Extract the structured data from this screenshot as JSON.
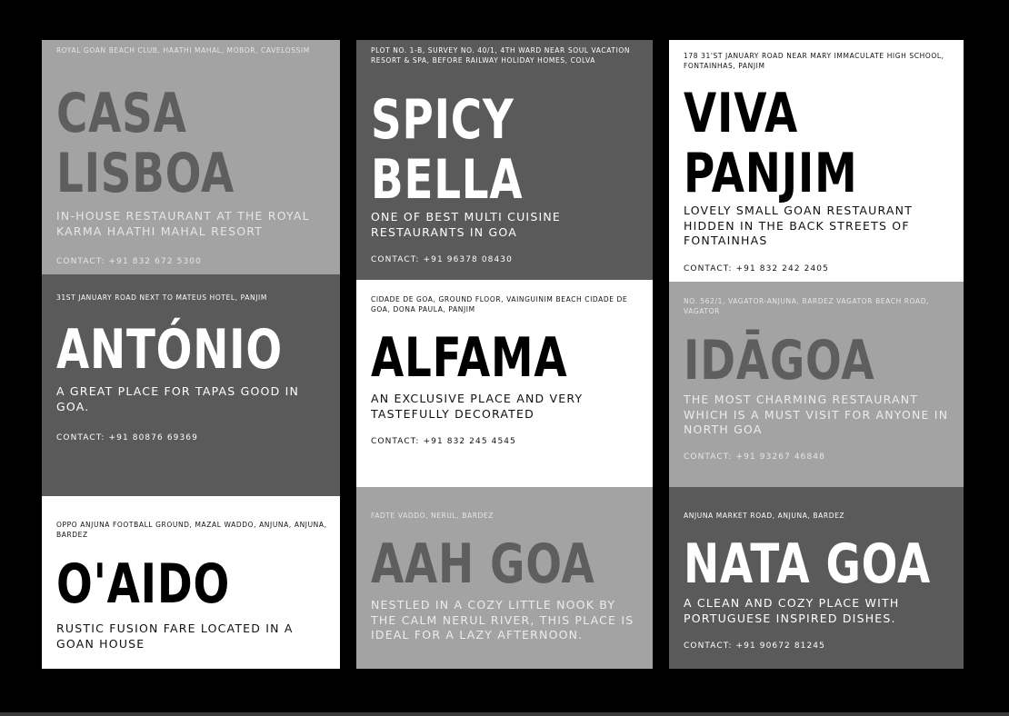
{
  "colors": {
    "background": "#000000",
    "light_gray": "#a3a3a3",
    "dark_gray": "#5a5a5a",
    "white": "#ffffff"
  },
  "cards": [
    {
      "address": "ROYAL GOAN BEACH CLUB, HAATHI MAHAL, MOBOR, CAVELOSSIM",
      "name": "CASA\nLISBOA",
      "description": " IN-HOUSE RESTAURANT AT THE ROYAL KARMA HAATHI MAHAL RESORT",
      "contact": "CONTACT: +91 832 672 5300"
    },
    {
      "address": "PLOT NO. 1-B, SURVEY NO. 40/1, 4TH WARD NEAR SOUL VACATION RESORT & SPA, BEFORE RAILWAY HOLIDAY HOMES, COLVA",
      "name": "SPICY\nBELLA",
      "description": "ONE OF BEST MULTI CUISINE RESTAURANTS IN GOA",
      "contact": "CONTACT: +91 96378 08430"
    },
    {
      "address": "178 31'ST JANUARY ROAD NEAR MARY IMMACULATE HIGH SCHOOL, FONTAINHAS, PANJIM",
      "name": "VIVA\nPANJIM",
      "description": "LOVELY SMALL GOAN RESTAURANT HIDDEN IN THE BACK STREETS OF FONTAINHAS",
      "contact": "CONTACT: +91 832 242 2405"
    },
    {
      "address": "31ST JANUARY ROAD NEXT TO MATEUS HOTEL, PANJIM",
      "name": "ANTÓNIO",
      "description": "A GREAT PLACE FOR TAPAS GOOD IN GOA.",
      "contact": "CONTACT: +91 80876 69369"
    },
    {
      "address": "CIDADE DE GOA, GROUND FLOOR, VAINGUINIM BEACH CIDADE DE GOA, DONA PAULA, PANJIM",
      "name": "ALFAMA",
      "description": "AN EXCLUSIVE PLACE AND VERY TASTEFULLY DECORATED",
      "contact": "CONTACT: +91 832 245 4545"
    },
    {
      "address": "NO. 562/1, VAGATOR-ANJUNA, BARDEZ VAGATOR BEACH ROAD, VAGATOR",
      "name": "IDĀGOA",
      "description": "THE MOST CHARMING RESTAURANT WHICH IS A MUST VISIT FOR ANYONE IN NORTH GOA",
      "contact": "CONTACT: +91 93267 46848"
    },
    {
      "address": "OPPO ANJUNA FOOTBALL GROUND, MAZAL WADDO, ANJUNA, ANJUNA, BARDEZ",
      "name": "O'AIDO",
      "description": "RUSTIC FUSION FARE LOCATED IN A GOAN HOUSE",
      "contact": ""
    },
    {
      "address": "FADTE VADDO, NERUL, BARDEZ",
      "name": "AAH GOA",
      "description": "NESTLED IN A COZY LITTLE NOOK BY THE CALM NERUL RIVER, THIS PLACE IS IDEAL FOR A LAZY AFTERNOON.",
      "contact": ""
    },
    {
      "address": "ANJUNA MARKET ROAD, ANJUNA, BARDEZ",
      "name": "NATA GOA",
      "description": "A CLEAN AND COZY PLACE WITH PORTUGUESE INSPIRED DISHES.",
      "contact": "CONTACT: +91 90672 81245"
    }
  ]
}
